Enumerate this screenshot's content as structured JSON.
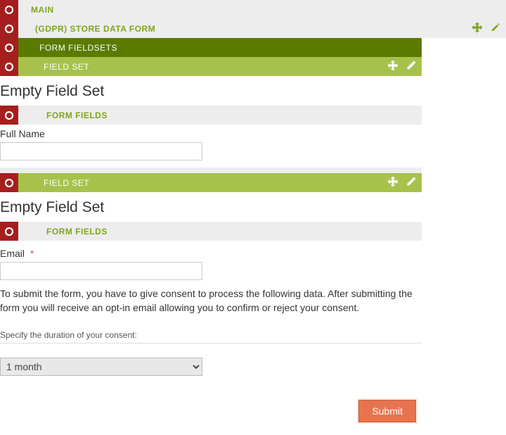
{
  "bars": {
    "main": "MAIN",
    "gdpr": "(GDPR) STORE DATA FORM",
    "fieldsets": "FORM FIELDSETS",
    "fieldset1": "FIELD SET",
    "fieldset2": "FIELD SET",
    "formfields1": "FORM FIELDS",
    "formfields2": "FORM FIELDS"
  },
  "section1": {
    "title": "Empty Field Set",
    "field_label": "Full Name",
    "field_value": ""
  },
  "section2": {
    "title": "Empty Field Set",
    "field_label": "Email",
    "required_mark": "*",
    "field_value": ""
  },
  "consent": {
    "text": "To submit the form, you have to give consent to process the following data. After submitting the form you will receive an opt-in email allowing you to confirm or reject your consent.",
    "duration_label": "Specify the duration of your consent:",
    "selected": "1 month"
  },
  "submit_label": "Submit"
}
